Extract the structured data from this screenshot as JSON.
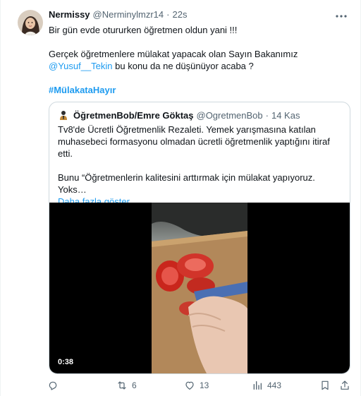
{
  "post": {
    "author_name": "Nermissy",
    "author_handle": "@Nerminylmzr14",
    "separator": "·",
    "time": "22s",
    "text_line1": "Bir gün evde otururken öğretmen oldun yani !!!",
    "text_line2": "Gerçek öğretmenlere mülakat yapacak olan Sayın Bakanımız",
    "mention": "@Yusuf__Tekin",
    "text_line3_rest": " bu konu da ne düşünüyor acaba ?",
    "hashtag": "#MülakataHayır"
  },
  "quote": {
    "author_name": "ÖğretmenBob/Emre Göktaş",
    "author_handle": "@OgretmenBob",
    "separator": "·",
    "time": "14 Kas",
    "line1": "Tv8'de Ücretli Öğretmenlik Rezaleti. Yemek yarışmasına katılan",
    "line2": "muhasebeci formasyonu olmadan ücretli öğretmenlik yaptığını itiraf",
    "line3": "etti.",
    "line4": "Bunu “Öğretmenlerin kalitesini arttırmak için mülakat yapıyoruz. Yoks…",
    "show_more": "Daha fazla göster",
    "video_duration": "0:38"
  },
  "actions": {
    "reply_count": "",
    "repost_count": "6",
    "like_count": "13",
    "views_count": "443"
  },
  "icons": {
    "more": "more-icon",
    "reply": "reply-icon",
    "repost": "repost-icon",
    "like": "like-icon",
    "views": "views-icon",
    "bookmark": "bookmark-icon",
    "share": "share-icon"
  },
  "colors": {
    "link": "#1d9bf0",
    "text": "#0f1419",
    "muted": "#536471",
    "border": "#cfd9de"
  }
}
